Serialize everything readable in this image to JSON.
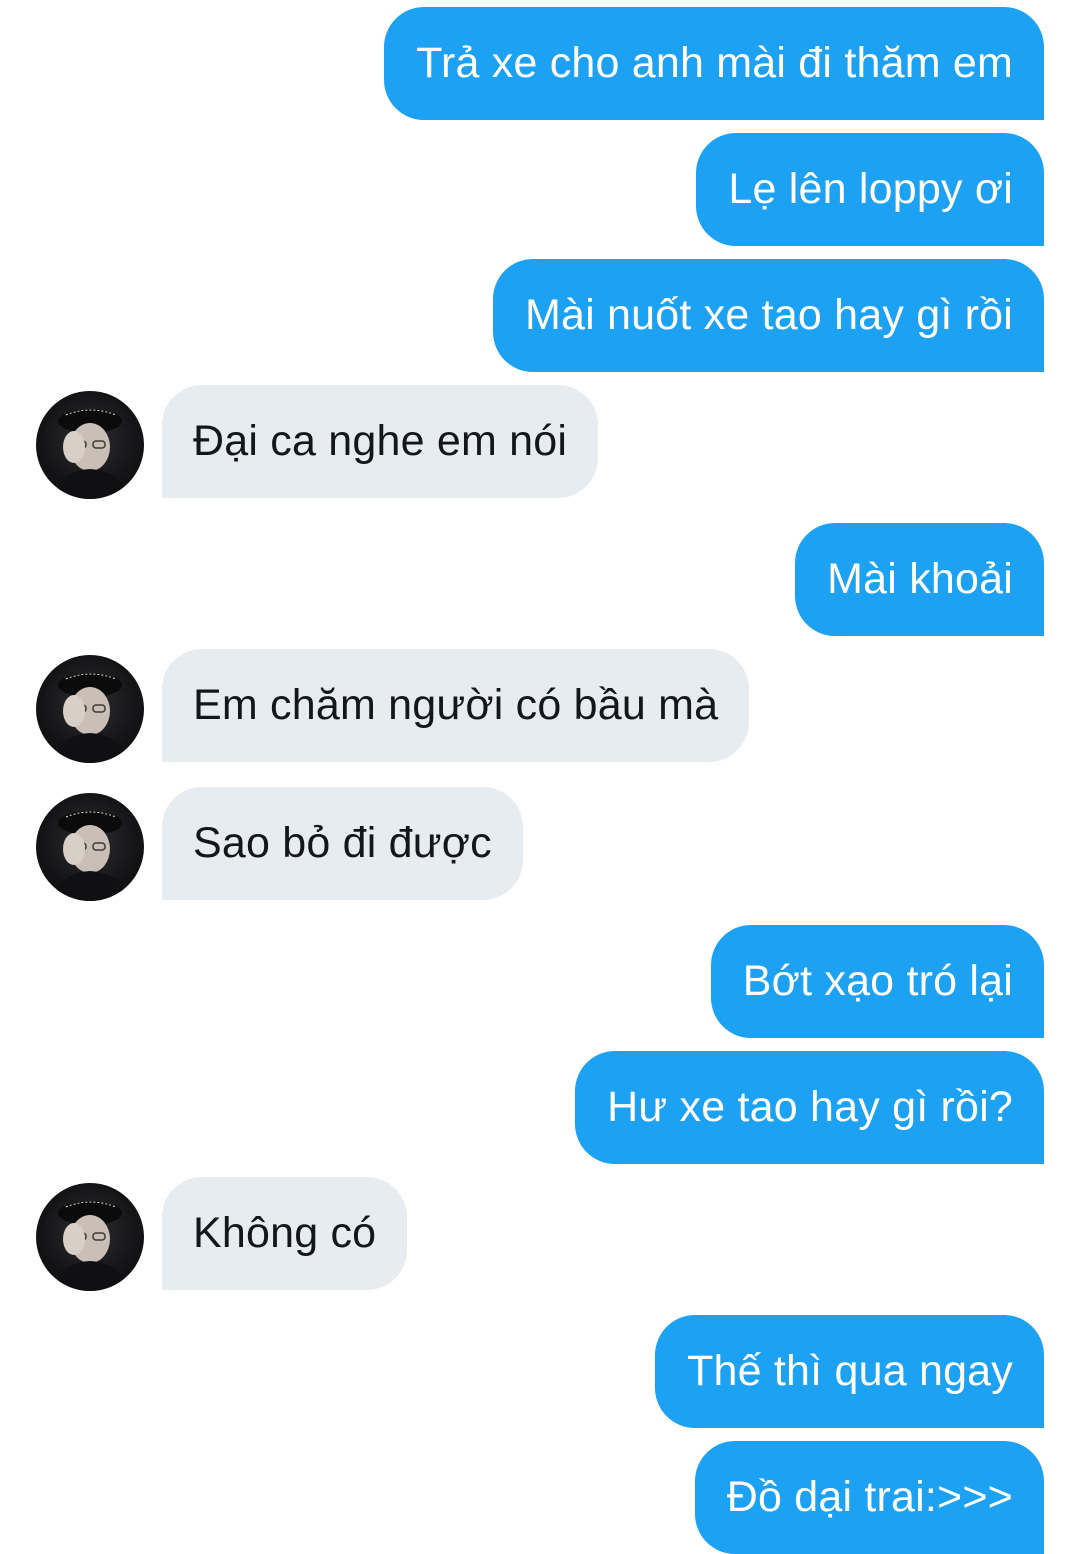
{
  "conversation": {
    "messages": [
      {
        "sender": "me",
        "text": "Trả xe cho anh mài đi thăm em"
      },
      {
        "sender": "me",
        "text": "Lẹ lên loppy ơi"
      },
      {
        "sender": "me",
        "text": "Mài nuốt xe tao hay gì rồi"
      },
      {
        "sender": "them",
        "text": "Đại ca nghe em nói"
      },
      {
        "sender": "me",
        "text": "Mài khoải"
      },
      {
        "sender": "them",
        "text": "Em chăm người có bầu mà"
      },
      {
        "sender": "them",
        "text": "Sao bỏ đi được"
      },
      {
        "sender": "me",
        "text": "Bớt xạo tró lại"
      },
      {
        "sender": "me",
        "text": "Hư xe tao hay gì rồi?"
      },
      {
        "sender": "them",
        "text": "Không có"
      },
      {
        "sender": "me",
        "text": "Thế thì qua ngay"
      },
      {
        "sender": "me",
        "text": "Đồ dại trai:>>>"
      }
    ]
  },
  "colors": {
    "sent_bubble": "#1da1f2",
    "sent_text": "#ffffff",
    "received_bubble": "#e6ecf0",
    "received_text": "#14171a"
  },
  "icons": {
    "contact_avatar": "avatar-photo"
  }
}
